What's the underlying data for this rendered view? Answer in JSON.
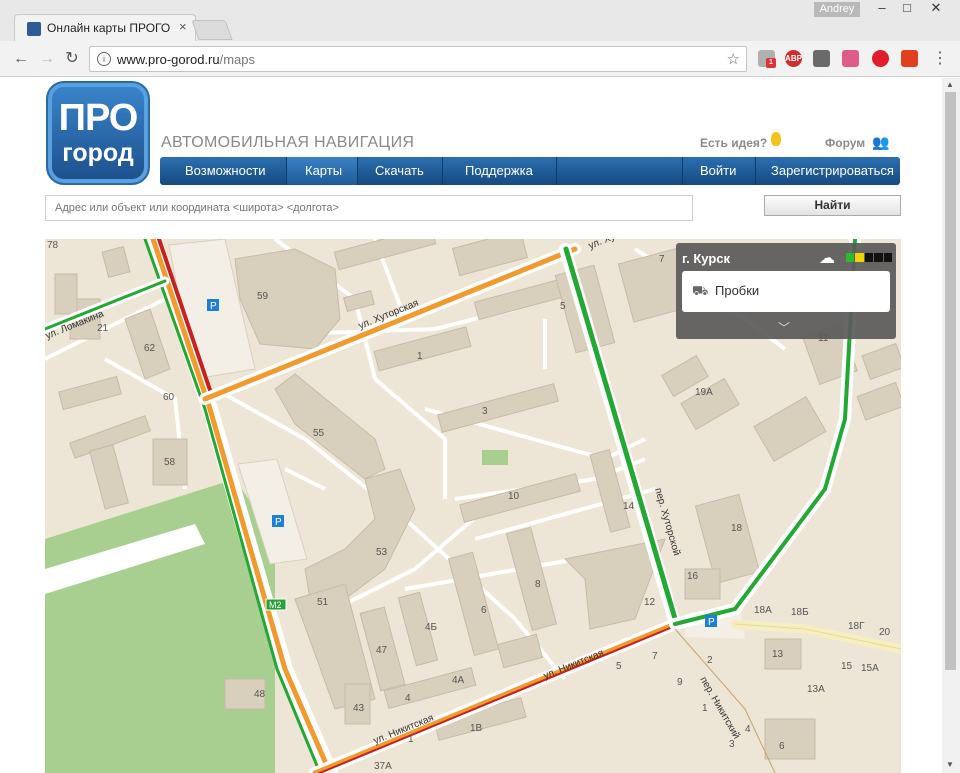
{
  "browser": {
    "tab_title": "Онлайн карты ПРОГОРО",
    "tab_close": "×",
    "user": "Andrey",
    "window_min": "–",
    "window_max": "□",
    "window_close": "✕",
    "url_host": "www.pro-gorod.ru",
    "url_path": "/maps",
    "ext_badge": "1",
    "ext_abp": "ABP"
  },
  "header": {
    "logo_line1": "ПРО",
    "logo_line2": "город",
    "title": "АВТОМОБИЛЬНАЯ НАВИГАЦИЯ",
    "idea": "Есть идея?",
    "forum": "Форум"
  },
  "menu": {
    "items": [
      "Возможности",
      "Карты",
      "Скачать",
      "Поддержка"
    ],
    "login": "Войти",
    "register": "Зарегистрироваться",
    "active": "Карты"
  },
  "search": {
    "placeholder": "Адрес или объект или координата <широта> <долгота>",
    "button": "Найти"
  },
  "panel": {
    "city": "г. Курск",
    "traffic": "Пробки",
    "traffic_colors": [
      "#2db82d",
      "#f2d200",
      "#111111",
      "#111111",
      "#111111"
    ]
  },
  "map": {
    "streets": [
      "ул. Хуторская",
      "ул. Никитская",
      "пер. Хуторской",
      "пер. Никитский",
      "ул. Ломакина"
    ],
    "road_badge": "M2",
    "parking": "P",
    "house_numbers": [
      "78",
      "59",
      "21",
      "62",
      "60",
      "58",
      "55",
      "53",
      "51",
      "47",
      "4Б",
      "4А",
      "4",
      "43",
      "48",
      "1",
      "3",
      "10",
      "8",
      "6",
      "14",
      "12",
      "16",
      "18",
      "5",
      "7",
      "11",
      "19А",
      "18А",
      "18Б",
      "18Г",
      "20",
      "13",
      "15",
      "15А",
      "13А",
      "2",
      "4",
      "3",
      "6",
      "5",
      "7",
      "9",
      "1",
      "1В",
      "37А",
      "1"
    ],
    "colors": {
      "background": "#ede5d6",
      "building": "#d9cfbd",
      "road": "#ffffff",
      "green": "#a8cf8f",
      "traffic_green": "#22a833",
      "traffic_orange": "#f29a2e",
      "traffic_red": "#c8201e"
    }
  }
}
